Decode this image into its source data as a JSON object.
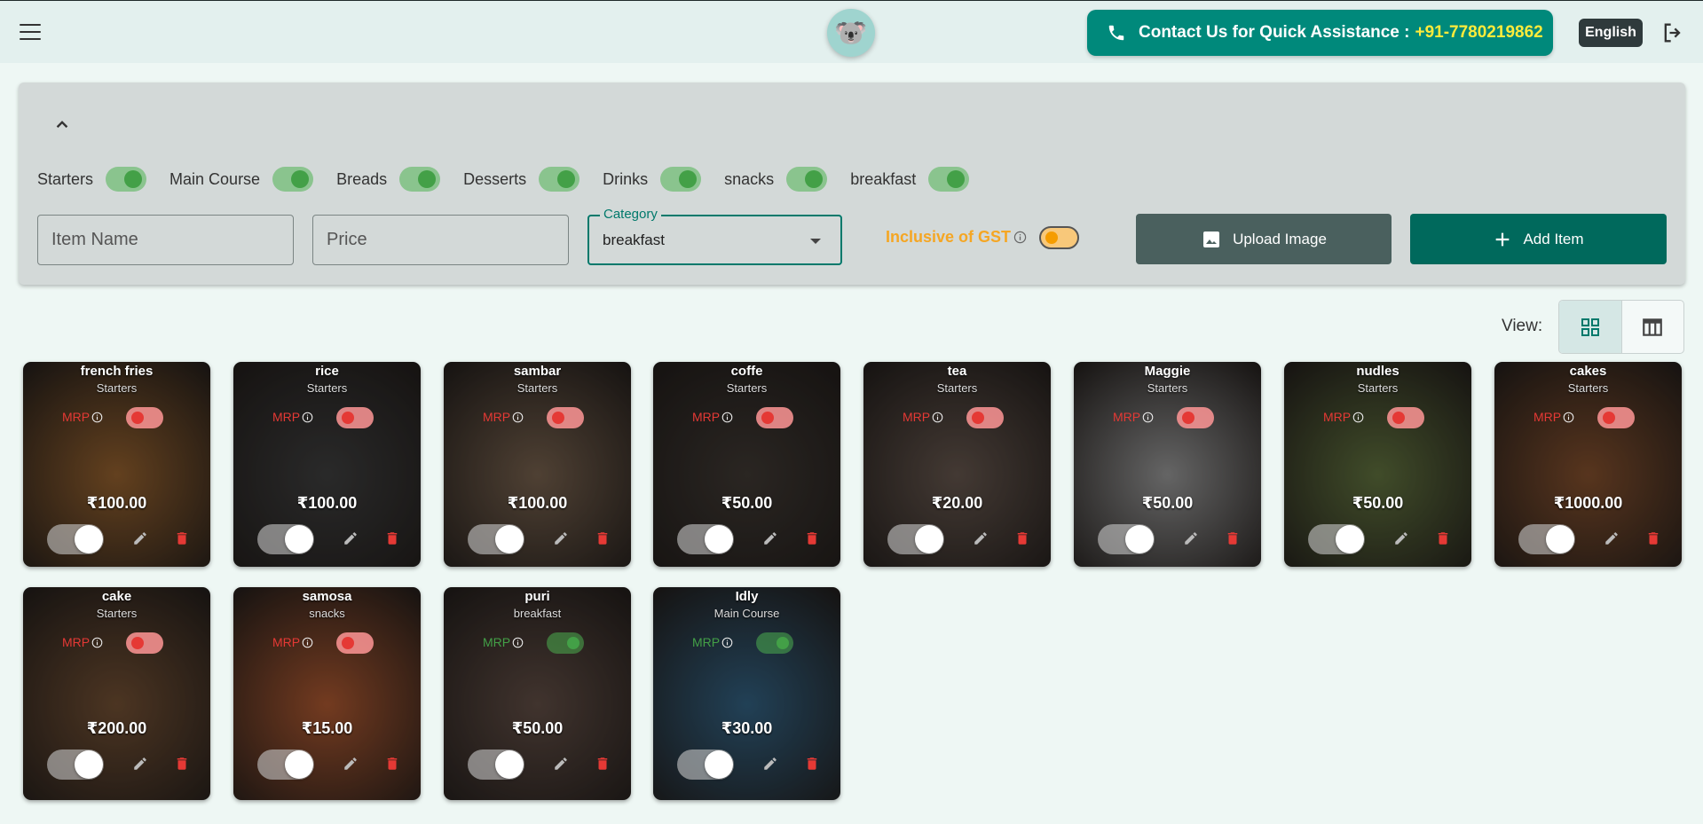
{
  "header": {
    "menu_icon": "hamburger-icon",
    "logo_icon": "koala-logo",
    "logo_glyph": "🐨",
    "contact_label": "Contact Us for Quick Assistance :",
    "contact_number": "+91-7780219862",
    "language": "English",
    "logout_icon": "logout-icon"
  },
  "categories": [
    {
      "label": "Starters",
      "enabled": true
    },
    {
      "label": "Main Course",
      "enabled": true
    },
    {
      "label": "Breads",
      "enabled": true
    },
    {
      "label": "Desserts",
      "enabled": true
    },
    {
      "label": "Drinks",
      "enabled": true
    },
    {
      "label": "snacks",
      "enabled": true
    },
    {
      "label": "breakfast",
      "enabled": true
    }
  ],
  "form": {
    "item_name_placeholder": "Item Name",
    "price_placeholder": "Price",
    "category_label": "Category",
    "category_value": "breakfast",
    "gst_label": "Inclusive of GST",
    "gst_enabled": false,
    "upload_label": "Upload Image",
    "add_label": "Add Item"
  },
  "view": {
    "label": "View:",
    "active": "grid"
  },
  "items": [
    {
      "name": "french fries",
      "category": "Starters",
      "mrp_label": "MRP",
      "mrp_enabled": false,
      "price": "₹100.00",
      "available": true,
      "bg": "#8a5a2b"
    },
    {
      "name": "rice",
      "category": "Starters",
      "mrp_label": "MRP",
      "mrp_enabled": false,
      "price": "₹100.00",
      "available": true,
      "bg": "#3a3a3a"
    },
    {
      "name": "sambar",
      "category": "Starters",
      "mrp_label": "MRP",
      "mrp_enabled": false,
      "price": "₹100.00",
      "available": true,
      "bg": "#6e5a48"
    },
    {
      "name": "coffe",
      "category": "Starters",
      "mrp_label": "MRP",
      "mrp_enabled": false,
      "price": "₹50.00",
      "available": true,
      "bg": "#3b3530"
    },
    {
      "name": "tea",
      "category": "Starters",
      "mrp_label": "MRP",
      "mrp_enabled": false,
      "price": "₹20.00",
      "available": true,
      "bg": "#5e5048"
    },
    {
      "name": "Maggie",
      "category": "Starters",
      "mrp_label": "MRP",
      "mrp_enabled": false,
      "price": "₹50.00",
      "available": true,
      "bg": "#8c8c8c"
    },
    {
      "name": "nudles",
      "category": "Starters",
      "mrp_label": "MRP",
      "mrp_enabled": false,
      "price": "₹50.00",
      "available": true,
      "bg": "#5a6a3a"
    },
    {
      "name": "cakes",
      "category": "Starters",
      "mrp_label": "MRP",
      "mrp_enabled": false,
      "price": "₹1000.00",
      "available": true,
      "bg": "#7a4a2a"
    },
    {
      "name": "cake",
      "category": "Starters",
      "mrp_label": "MRP",
      "mrp_enabled": false,
      "price": "₹200.00",
      "available": true,
      "bg": "#6a4a30"
    },
    {
      "name": "samosa",
      "category": "snacks",
      "mrp_label": "MRP",
      "mrp_enabled": false,
      "price": "₹15.00",
      "available": true,
      "bg": "#a0522d"
    },
    {
      "name": "puri",
      "category": "breakfast",
      "mrp_label": "MRP",
      "mrp_enabled": true,
      "price": "₹50.00",
      "available": true,
      "bg": "#5a4840"
    },
    {
      "name": "Idly",
      "category": "Main Course",
      "mrp_label": "MRP",
      "mrp_enabled": true,
      "price": "₹30.00",
      "available": true,
      "bg": "#2f5a78"
    }
  ],
  "colors": {
    "accent": "#00897b",
    "contact_number": "#ffeb3b",
    "gst_label": "#f5a623",
    "mrp_off": "#e53935",
    "mrp_on": "#43a047",
    "delete": "#e53935"
  }
}
